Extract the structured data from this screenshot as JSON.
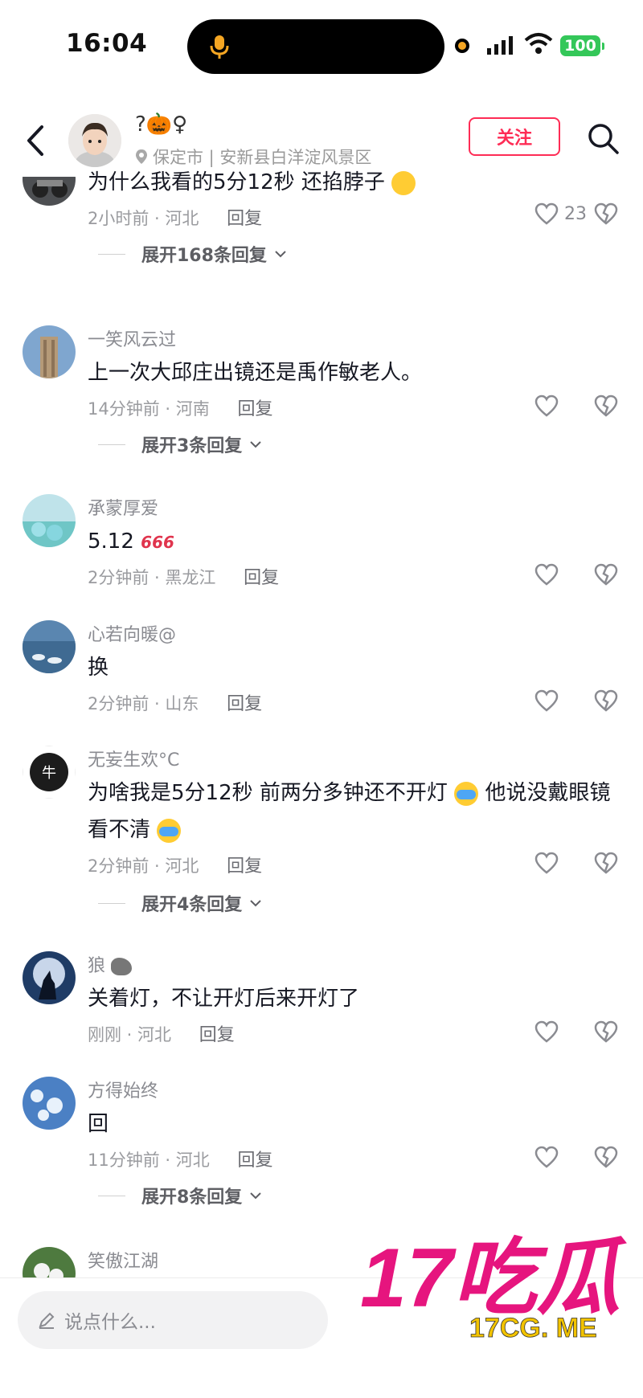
{
  "status_bar": {
    "time": "16:04",
    "battery": "100"
  },
  "header": {
    "account_name": "?🎃♀",
    "location": "保定市 | 安新县白洋淀风景区",
    "follow_label": "关注"
  },
  "comments": [
    {
      "username": "",
      "text": "为什么我看的5分12秒 还掐脖子",
      "time_region": "2小时前 · 河北",
      "reply_label": "回复",
      "likes": "23",
      "expand_label": "展开168条回复"
    },
    {
      "username": "一笑风云过",
      "text": "上一次大邱庄出镜还是禹作敏老人。",
      "time_region": "14分钟前 · 河南",
      "reply_label": "回复",
      "likes": "",
      "expand_label": "展开3条回复"
    },
    {
      "username": "承蒙厚爱",
      "text": "5.12",
      "text_suffix": "666",
      "time_region": "2分钟前 · 黑龙江",
      "reply_label": "回复",
      "likes": ""
    },
    {
      "username": "心若向暖@",
      "text": "换",
      "time_region": "2分钟前 · 山东",
      "reply_label": "回复",
      "likes": ""
    },
    {
      "username": "无妄生欢°C",
      "text_part1": "为啥我是5分12秒 前两分多钟还不开灯",
      "text_part2": "他说没戴眼镜看不清",
      "time_region": "2分钟前 · 河北",
      "reply_label": "回复",
      "likes": "",
      "expand_label": "展开4条回复"
    },
    {
      "username": "狼",
      "text": "关着灯，不让开灯后来开灯了",
      "time_region": "刚刚 · 河北",
      "reply_label": "回复",
      "likes": ""
    },
    {
      "username": "方得始终",
      "text": "回",
      "time_region": "11分钟前 · 河北",
      "reply_label": "回复",
      "likes": "",
      "expand_label": "展开8条回复"
    },
    {
      "username": "笑傲江湖"
    }
  ],
  "input": {
    "placeholder": "说点什么..."
  },
  "watermark": {
    "big": "17吃瓜",
    "small": "17CG. ME"
  },
  "colors": {
    "accent": "#fe2c55",
    "battery": "#34c759",
    "watermark": "#e6157e"
  },
  "icons": [
    "back-arrow-icon",
    "location-pin-icon",
    "search-icon",
    "heart-icon",
    "dislike-icon",
    "pencil-icon",
    "mic-icon",
    "wifi-icon",
    "signal-icon"
  ]
}
